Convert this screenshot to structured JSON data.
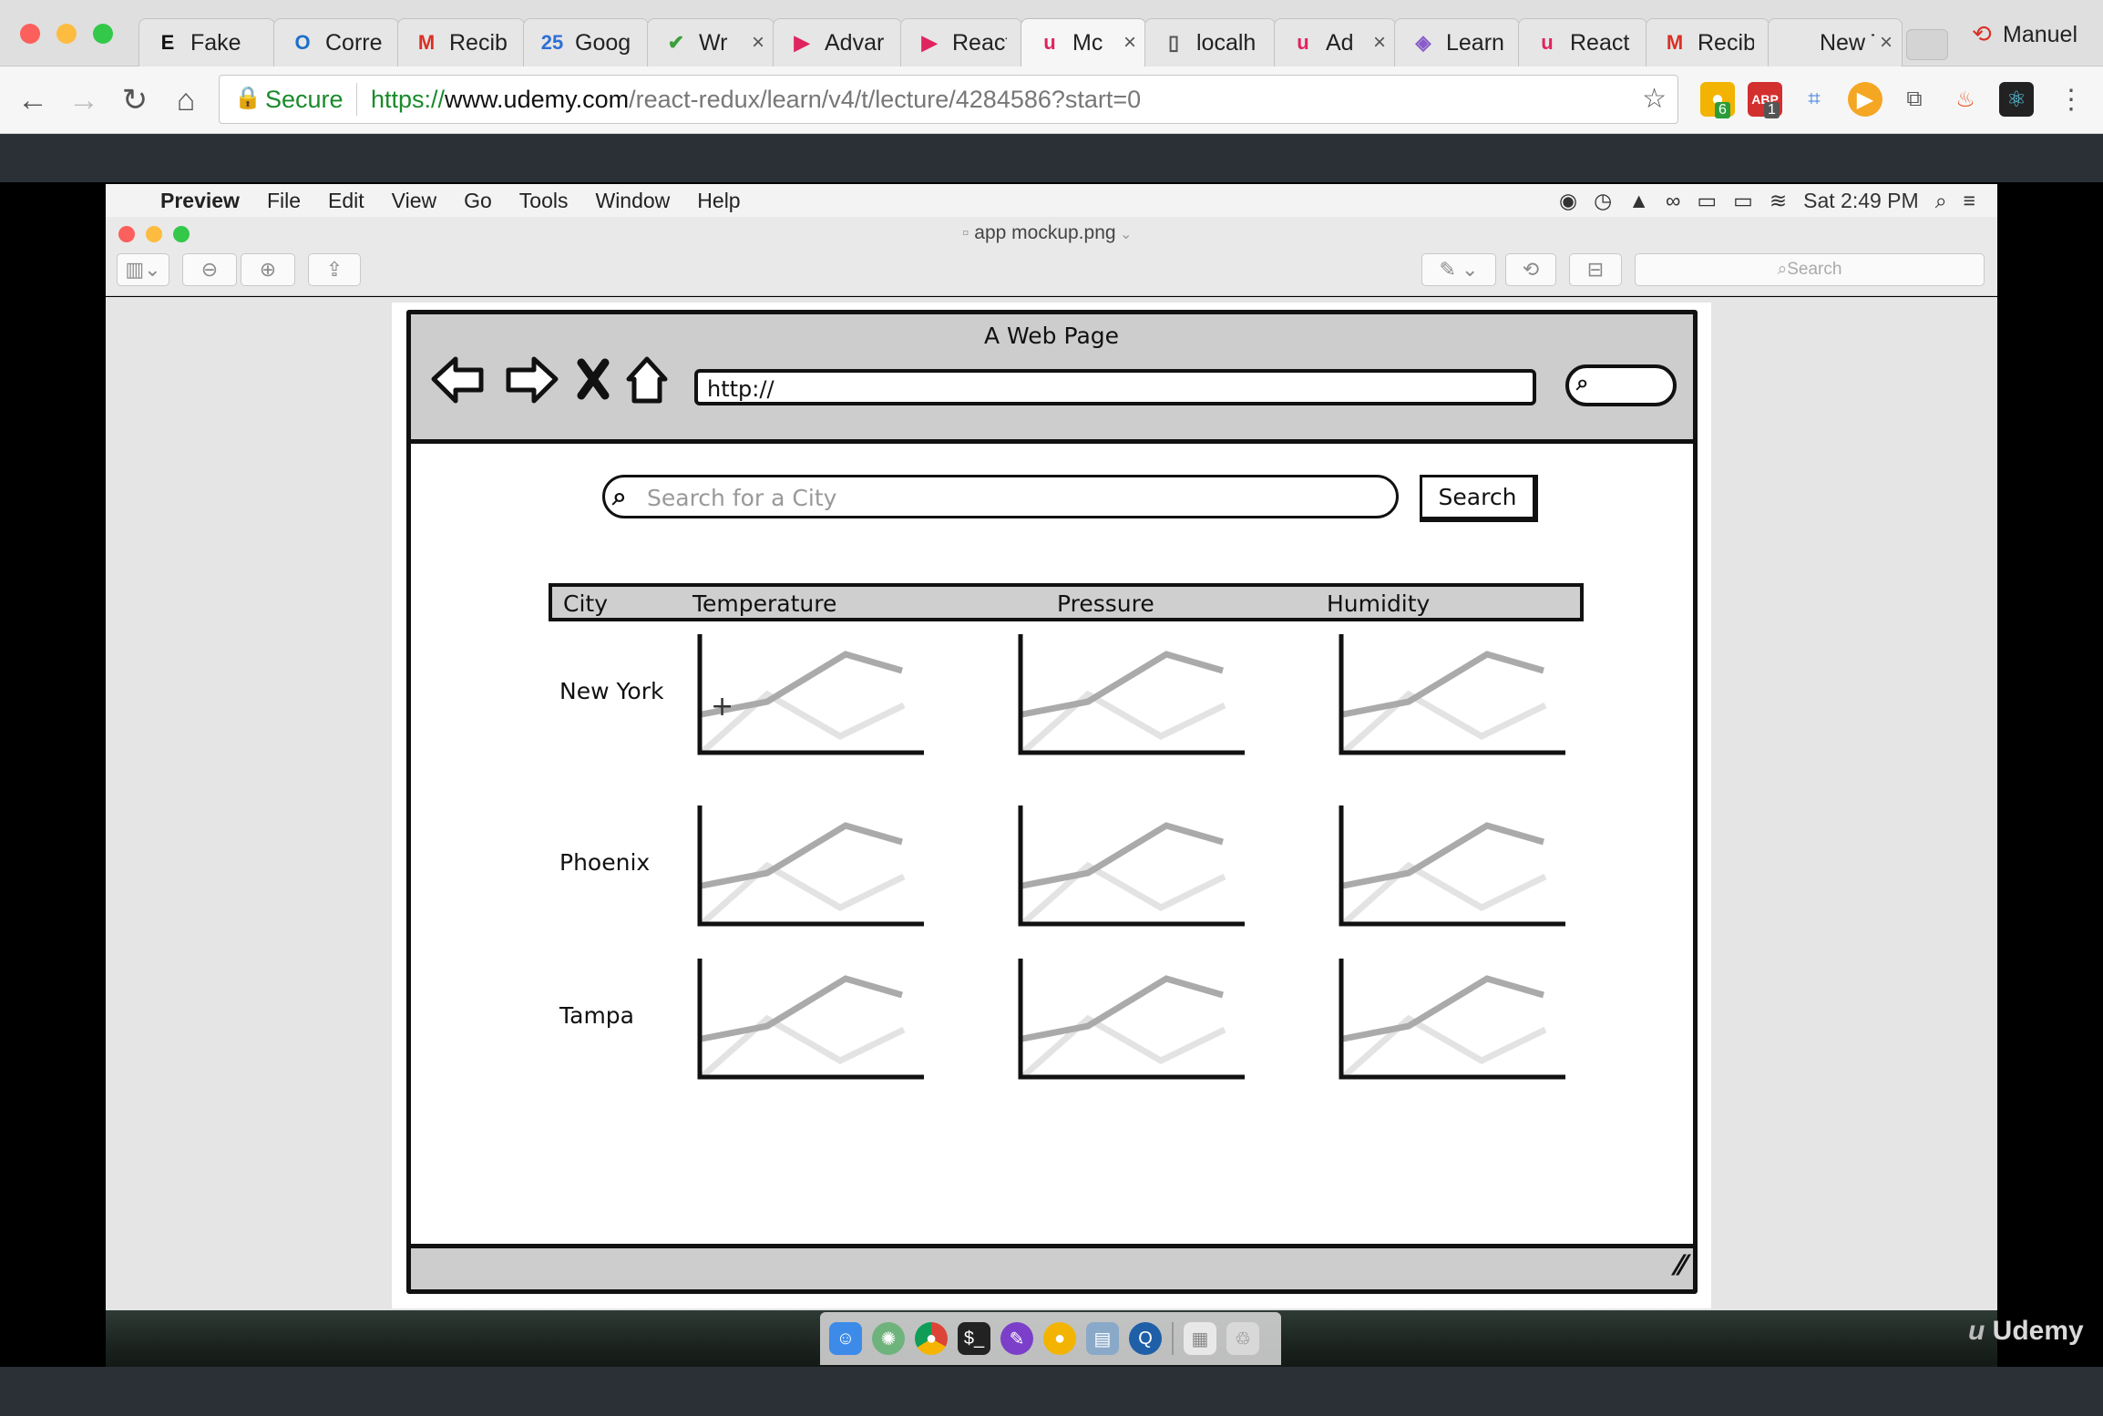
{
  "browser": {
    "tabs": [
      {
        "label": "Fake",
        "icon": "E",
        "icon_color": "#111111",
        "close": ""
      },
      {
        "label": "Corre",
        "icon": "O",
        "icon_color": "#1e6fc8",
        "close": ""
      },
      {
        "label": "Recib",
        "icon": "M",
        "icon_color": "#d93025",
        "close": ""
      },
      {
        "label": "Goog",
        "icon": "25",
        "icon_color": "#2f6fd6",
        "close": ""
      },
      {
        "label": "Wr",
        "icon": "✔",
        "icon_color": "#3aa03a",
        "close": "×"
      },
      {
        "label": "Advar",
        "icon": "▶",
        "icon_color": "#e0245e",
        "close": ""
      },
      {
        "label": "React",
        "icon": "▶",
        "icon_color": "#e0245e",
        "close": ""
      },
      {
        "label": "Mc",
        "icon": "u",
        "icon_color": "#e0245e",
        "close": "×"
      },
      {
        "label": "localh",
        "icon": "▯",
        "icon_color": "#555555",
        "close": ""
      },
      {
        "label": "Ad",
        "icon": "u",
        "icon_color": "#e0245e",
        "close": "×"
      },
      {
        "label": "Learn",
        "icon": "◈",
        "icon_color": "#8a5cc9",
        "close": ""
      },
      {
        "label": "React",
        "icon": "u",
        "icon_color": "#e0245e",
        "close": ""
      },
      {
        "label": "Recib",
        "icon": "M",
        "icon_color": "#d93025",
        "close": ""
      },
      {
        "label": "New T",
        "icon": "",
        "icon_color": "#555555",
        "close": "×"
      }
    ],
    "profile_name": "Manuel",
    "secure_label": "Secure",
    "url_scheme": "https://",
    "url_host": "www.udemy.com",
    "url_path": "/react-redux/learn/v4/t/lecture/4284586?start=0",
    "extension_badges": [
      "6",
      "1"
    ]
  },
  "mac": {
    "app_name": "Preview",
    "menus": [
      "File",
      "Edit",
      "View",
      "Go",
      "Tools",
      "Window",
      "Help"
    ],
    "clock": "Sat 2:49 PM",
    "document_title": "app mockup.png",
    "search_placeholder": "Search"
  },
  "mockup": {
    "page_title": "A Web Page",
    "url_text": "http://",
    "city_search_placeholder": "Search for a City",
    "search_button": "Search",
    "columns": [
      "City",
      "Temperature",
      "Pressure",
      "Humidity"
    ],
    "cities": [
      "New York",
      "Phoenix",
      "Tampa"
    ]
  },
  "watermark": "Udemy",
  "colors": {
    "secure_green": "#1a8a2a",
    "sketch_ink": "#111111",
    "sketch_gray": "#cdcdcd"
  }
}
